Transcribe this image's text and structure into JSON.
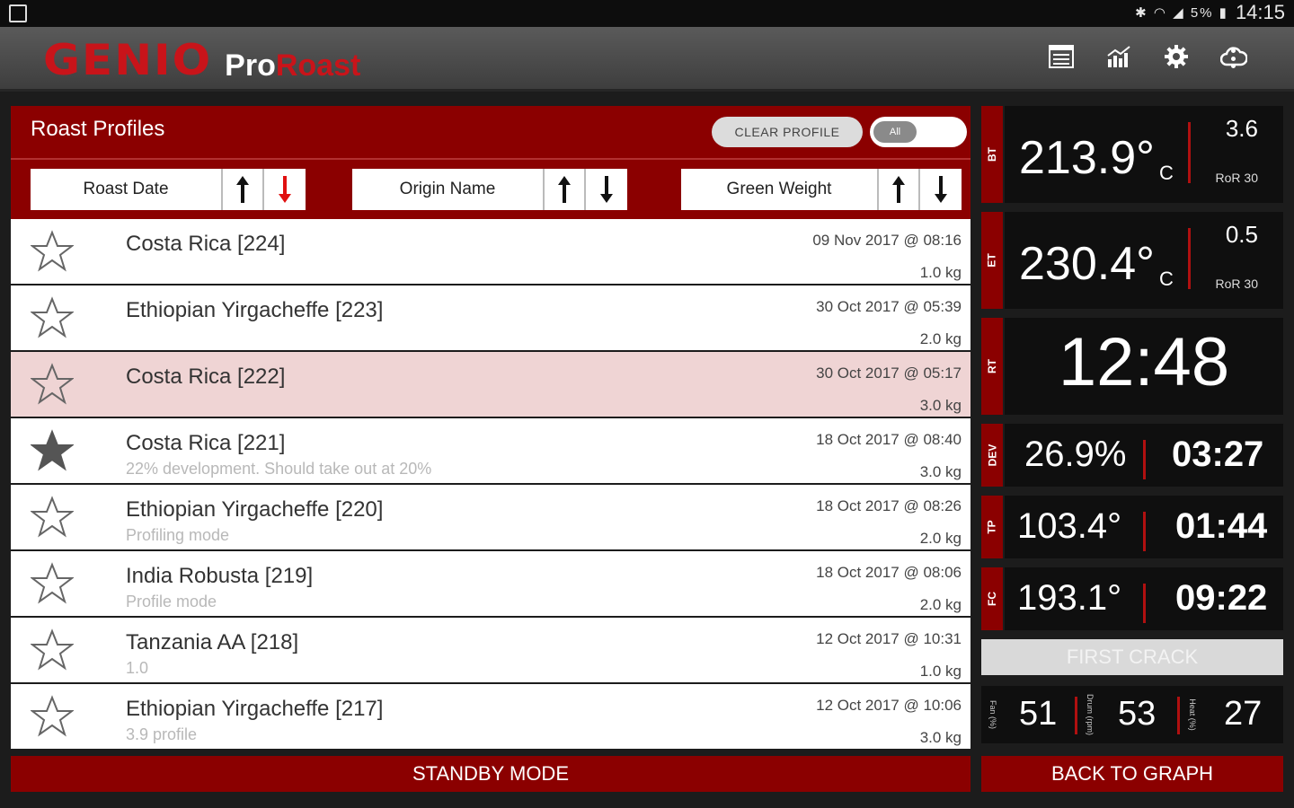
{
  "status": {
    "icons": "✱ ◠ ◢ 5% ▮",
    "time": "14:15"
  },
  "app": {
    "brand": "GENIO",
    "pro": "Pro",
    "roast": "Roast"
  },
  "panel": {
    "title": "Roast Profiles",
    "clear_label": "CLEAR PROFILE",
    "toggle_label": "All",
    "sorts": [
      {
        "label": "Roast Date"
      },
      {
        "label": "Origin Name"
      },
      {
        "label": "Green Weight"
      }
    ]
  },
  "profiles": [
    {
      "name": "Costa Rica  [224]",
      "note": "",
      "date": "09 Nov 2017 @ 08:16",
      "weight": "1.0 kg",
      "starred": false
    },
    {
      "name": "Ethiopian Yirgacheffe  [223]",
      "note": "",
      "date": "30 Oct 2017 @ 05:39",
      "weight": "2.0 kg",
      "starred": false
    },
    {
      "name": "Costa Rica  [222]",
      "note": "",
      "date": "30 Oct 2017 @ 05:17",
      "weight": "3.0 kg",
      "starred": false,
      "selected": true
    },
    {
      "name": "Costa Rica  [221]",
      "note": "22% development. Should take out at 20%",
      "date": "18 Oct 2017 @ 08:40",
      "weight": "3.0 kg",
      "starred": true
    },
    {
      "name": "Ethiopian Yirgacheffe  [220]",
      "note": "Profiling mode",
      "date": "18 Oct 2017 @ 08:26",
      "weight": "2.0 kg",
      "starred": false
    },
    {
      "name": "India Robusta  [219]",
      "note": "Profile mode",
      "date": "18 Oct 2017 @ 08:06",
      "weight": "2.0 kg",
      "starred": false
    },
    {
      "name": "Tanzania AA  [218]",
      "note": "1.0",
      "date": "12 Oct 2017 @ 10:31",
      "weight": "1.0 kg",
      "starred": false
    },
    {
      "name": "Ethiopian Yirgacheffe  [217]",
      "note": "3.9 profile",
      "date": "12 Oct 2017 @ 10:06",
      "weight": "3.0 kg",
      "starred": false
    }
  ],
  "buttons": {
    "standby": "STANDBY MODE",
    "back": "BACK TO GRAPH",
    "first_crack": "FIRST CRACK"
  },
  "readings": {
    "bt": {
      "tag": "BT",
      "value": "213.9°",
      "unit": "C",
      "ror": "3.6",
      "ror_label": "RoR 30"
    },
    "et": {
      "tag": "ET",
      "value": "230.4°",
      "unit": "C",
      "ror": "0.5",
      "ror_label": "RoR 30"
    },
    "rt": {
      "tag": "RT",
      "value": "12:48"
    },
    "dev": {
      "tag": "DEV",
      "pct": "26.9%",
      "time": "03:27"
    },
    "tp": {
      "tag": "TP",
      "temp": "103.4°",
      "time": "01:44"
    },
    "fc": {
      "tag": "FC",
      "temp": "193.1°",
      "time": "09:22"
    }
  },
  "bottom": [
    {
      "label": "Fan (%)",
      "value": "51"
    },
    {
      "label": "Drum (rpm)",
      "value": "53"
    },
    {
      "label": "Heat (%)",
      "value": "27"
    }
  ],
  "colors": {
    "brand_red": "#c8141a",
    "header_red": "#8b0000",
    "selected_row": "#efd4d4"
  }
}
